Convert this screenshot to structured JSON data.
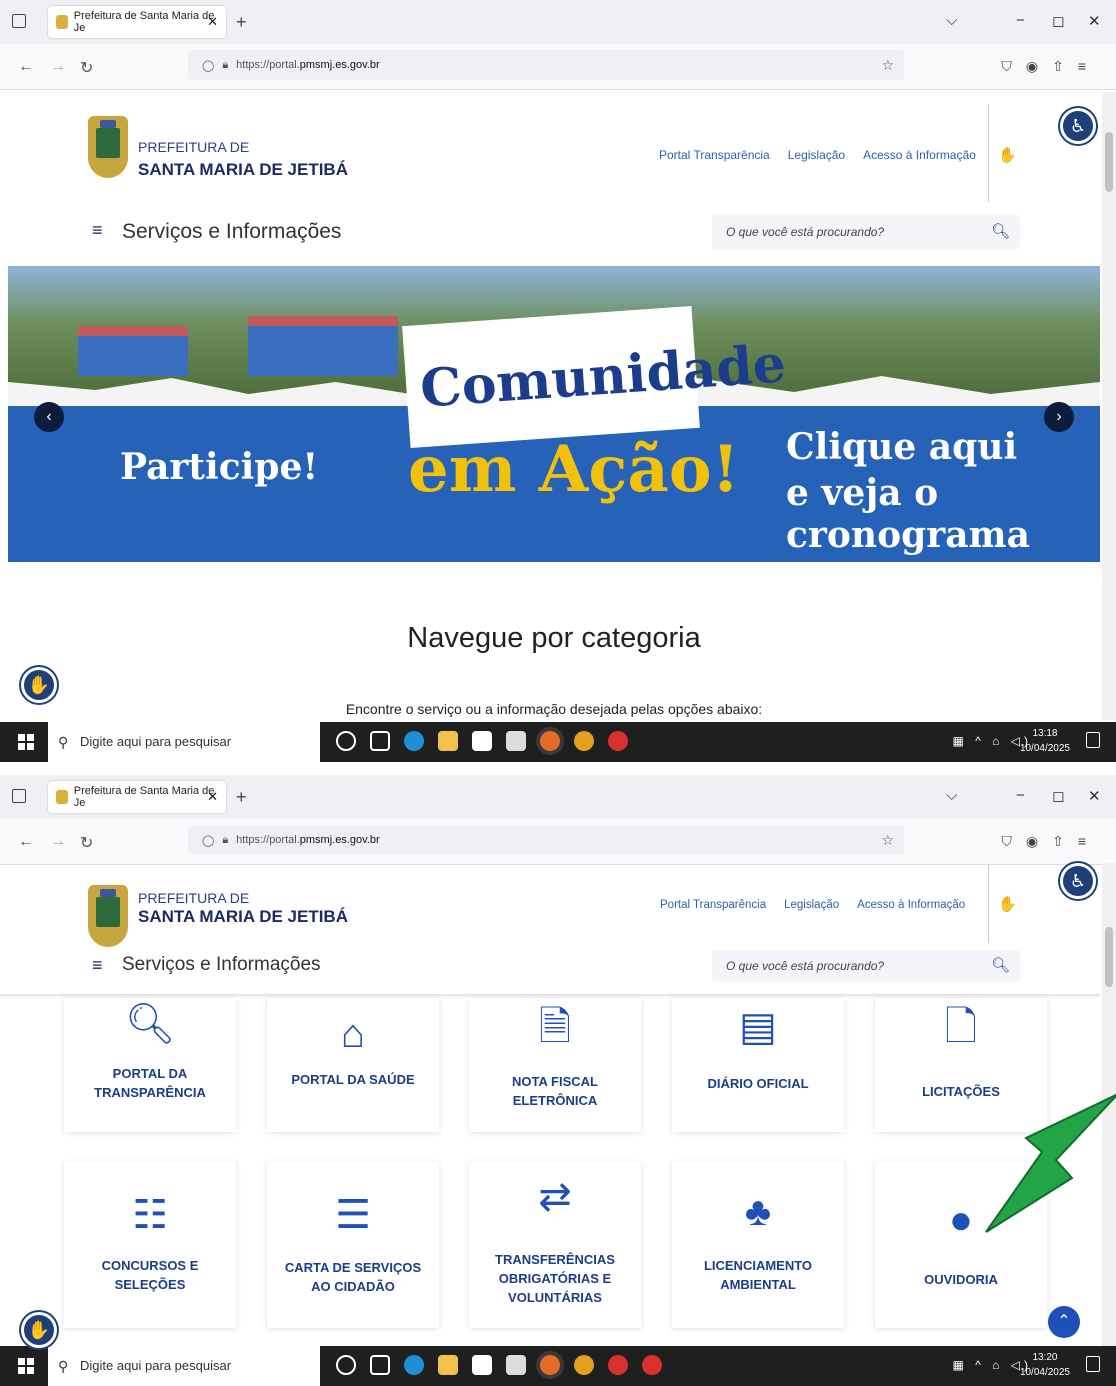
{
  "browser": {
    "tab_title": "Prefeitura de Santa Maria de Je",
    "url_prefix": "https://portal.",
    "url_domain": "pmsmj.es.gov.br",
    "minimize": "−",
    "maximize": "◻",
    "close": "✕"
  },
  "site": {
    "brand_line1": "PREFEITURA DE",
    "brand_line2": "SANTA MARIA DE JETIBÁ",
    "links": [
      "Portal Transparência",
      "Legislação",
      "Acesso à Informação"
    ],
    "menu_title": "Serviços e Informações",
    "search_placeholder": "O que você está procurando?"
  },
  "banner": {
    "title_word1": "Comunidade",
    "title_word2": "em Ação!",
    "left_text": "Participe!",
    "right_line1": "Clique aqui",
    "right_line2": "e veja o cronograma"
  },
  "section": {
    "title": "Navegue por categoria",
    "subtitle": "Encontre o serviço ou a informação desejada pelas opções abaixo:"
  },
  "taskbar": {
    "search_placeholder": "Digite aqui para pesquisar",
    "time1": "13:18",
    "date1": "10/04/2025",
    "time2": "13:20",
    "date2": "10/04/2025"
  },
  "categories": [
    {
      "label": "PORTAL DA TRANSPARÊNCIA",
      "icon": "search-dollar-icon"
    },
    {
      "label": "PORTAL DA SAÚDE",
      "icon": "health-house-icon"
    },
    {
      "label": "NOTA FISCAL ELETRÔNICA",
      "icon": "invoice-icon"
    },
    {
      "label": "DIÁRIO OFICIAL",
      "icon": "newspaper-icon"
    },
    {
      "label": "LICITAÇÕES",
      "icon": "file-dollar-icon"
    },
    {
      "label": "CONCURSOS E SELEÇÕES",
      "icon": "people-group-icon"
    },
    {
      "label": "CARTA DE SERVIÇOS AO CIDADÃO",
      "icon": "list-icon"
    },
    {
      "label": "TRANSFERÊNCIAS OBRIGATÓRIAS E VOLUNTÁRIAS",
      "icon": "transfer-arrows-icon"
    },
    {
      "label": "LICENCIAMENTO AMBIENTAL",
      "icon": "tree-building-icon"
    },
    {
      "label": "OUVIDORIA",
      "icon": "speech-bubble-icon"
    }
  ],
  "colors": {
    "brand_blue": "#1f4fb8",
    "navy": "#1c3c8c",
    "banner_blue": "#2662b8",
    "arrow_green": "#22a447"
  }
}
